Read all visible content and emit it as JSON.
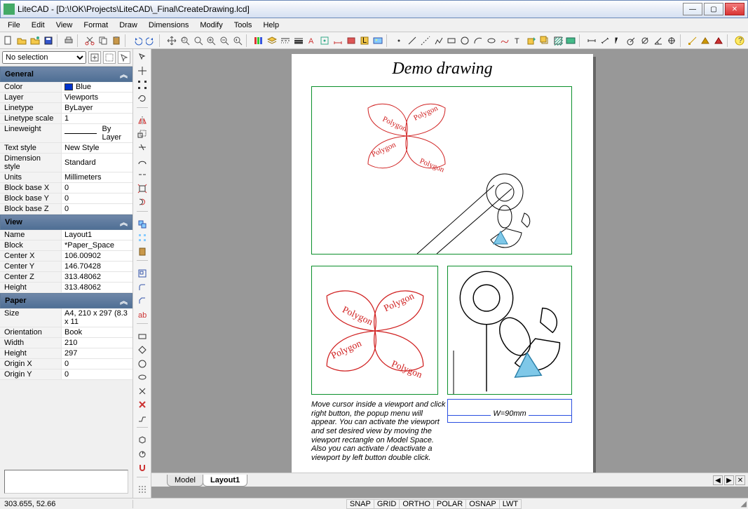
{
  "window": {
    "title": "LiteCAD - [D:\\!OK\\Projects\\LiteCAD\\_Final\\CreateDrawing.lcd]"
  },
  "menu": [
    "File",
    "Edit",
    "View",
    "Format",
    "Draw",
    "Dimensions",
    "Modify",
    "Tools",
    "Help"
  ],
  "selection": {
    "current": "No selection"
  },
  "groups": {
    "general": {
      "title": "General",
      "rows": [
        {
          "k": "Color",
          "v": "Blue",
          "swatch": "#0033cc"
        },
        {
          "k": "Layer",
          "v": "Viewports"
        },
        {
          "k": "Linetype",
          "v": "ByLayer"
        },
        {
          "k": "Linetype scale",
          "v": "1"
        },
        {
          "k": "Lineweight",
          "v": "By Layer",
          "line": true
        },
        {
          "k": "Text style",
          "v": "New Style"
        },
        {
          "k": "Dimension style",
          "v": "Standard"
        },
        {
          "k": "Units",
          "v": "Millimeters"
        },
        {
          "k": "Block base X",
          "v": "0"
        },
        {
          "k": "Block base Y",
          "v": "0"
        },
        {
          "k": "Block base Z",
          "v": "0"
        }
      ]
    },
    "view": {
      "title": "View",
      "rows": [
        {
          "k": "Name",
          "v": "Layout1"
        },
        {
          "k": "Block",
          "v": "*Paper_Space"
        },
        {
          "k": "Center X",
          "v": "106.00902"
        },
        {
          "k": "Center Y",
          "v": "146.70428"
        },
        {
          "k": "Center Z",
          "v": "313.48062"
        },
        {
          "k": "Height",
          "v": "313.48062"
        }
      ]
    },
    "paper": {
      "title": "Paper",
      "rows": [
        {
          "k": "Size",
          "v": "A4,  210 x 297 (8.3 x 11"
        },
        {
          "k": "Orientation",
          "v": "Book"
        },
        {
          "k": "Width",
          "v": "210"
        },
        {
          "k": "Height",
          "v": "297"
        },
        {
          "k": "Origin X",
          "v": "0"
        },
        {
          "k": "Origin Y",
          "v": "0"
        }
      ]
    }
  },
  "drawing": {
    "title": "Demo drawing",
    "petal_label": "Polygon",
    "dim_label": "W=90mm",
    "helper": "Move cursor inside a viewport and click right button, the popup menu will appear. You can activate the viewport and set desired view by moving the viewport rectangle on Model Space.\nAlso you can activate / deactivate a viewport by left button double click."
  },
  "tabs": {
    "model": "Model",
    "layout": "Layout1"
  },
  "status": {
    "coords": "303.655,  52.66",
    "toggles": [
      "SNAP",
      "GRID",
      "ORTHO",
      "POLAR",
      "OSNAP",
      "LWT"
    ]
  }
}
